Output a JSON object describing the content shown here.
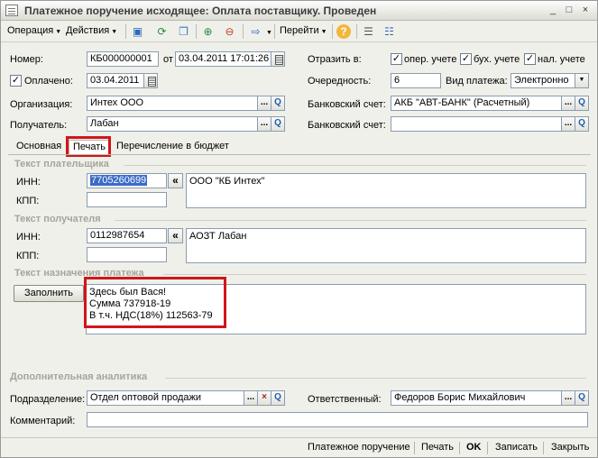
{
  "title": "Платежное поручение исходящее: Оплата поставщику. Проведен",
  "window_buttons": {
    "minimize": "_",
    "maximize": "□",
    "close": "×"
  },
  "toolbar": {
    "operation": "Операция",
    "actions": "Действия",
    "goto": "Перейти",
    "help": "?"
  },
  "header": {
    "number_label": "Номер:",
    "number_value": "КБ000000001",
    "from_label": "от",
    "date_value": "03.04.2011 17:01:26",
    "paid_label": "Оплачено:",
    "paid_checked": "✓",
    "paid_date": "03.04.2011",
    "org_label": "Организация:",
    "org_value": "Интех ООО",
    "recipient_label": "Получатель:",
    "recipient_value": "Лабан",
    "reflect_label": "Отразить в:",
    "reflect_oper": "опер. учете",
    "reflect_buh": "бух. учете",
    "reflect_nal": "нал. учете",
    "check_mark": "✓",
    "priority_label": "Очередность:",
    "priority_value": "6",
    "paytype_label": "Вид платежа:",
    "paytype_value": "Электронно",
    "bank_label": "Банковский счет:",
    "bank_value": "АКБ \"АВТ-БАНК\" (Расчетный)",
    "bank2_label": "Банковский счет:",
    "bank2_value": ""
  },
  "tabs": [
    {
      "label": "Основная"
    },
    {
      "label": "Печать"
    },
    {
      "label": "Перечисление в бюджет"
    }
  ],
  "payer": {
    "section": "Текст плательщика",
    "inn_label": "ИНН:",
    "inn_value": "7705260699",
    "kpp_label": "КПП:",
    "kpp_value": "",
    "text": "ООО \"КБ Интех\""
  },
  "receiver": {
    "section": "Текст получателя",
    "inn_label": "ИНН:",
    "inn_value": "0112987654",
    "kpp_label": "КПП:",
    "kpp_value": "",
    "text": "АОЗТ Лабан"
  },
  "purpose": {
    "section": "Текст назначения платежа",
    "fill_button": "Заполнить",
    "line1": "Здесь был Вася!",
    "line2": "Сумма 737918-19",
    "line3": "В т.ч. НДС(18%) 112563-79"
  },
  "extra": {
    "section": "Дополнительная аналитика",
    "dept_label": "Подразделение:",
    "dept_value": "Отдел оптовой продажи",
    "resp_label": "Ответственный:",
    "resp_value": "Федоров Борис Михайлович",
    "comment_label": "Комментарий:",
    "comment_value": ""
  },
  "field_buttons": {
    "dots": "...",
    "clear": "×",
    "search": "Q",
    "move": "«"
  },
  "bottom": {
    "payment_order": "Платежное поручение",
    "print": "Печать",
    "ok": "OK",
    "save": "Записать",
    "close": "Закрыть"
  },
  "colors": {
    "highlight": "#d0161b",
    "selection": "#3a6bc7"
  }
}
